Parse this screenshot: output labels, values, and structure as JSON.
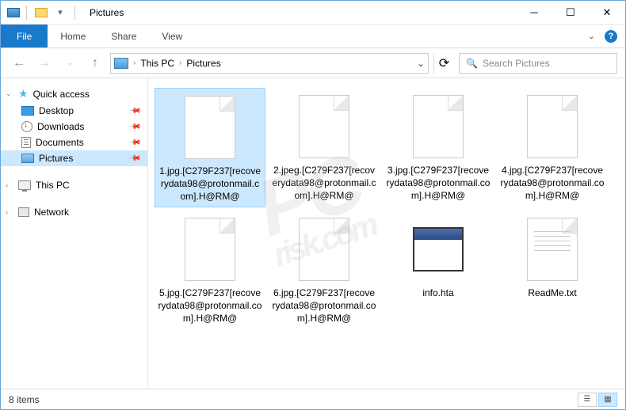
{
  "title": "Pictures",
  "ribbon": {
    "file": "File",
    "tabs": [
      "Home",
      "Share",
      "View"
    ]
  },
  "address": {
    "segments": [
      "This PC",
      "Pictures"
    ]
  },
  "search": {
    "placeholder": "Search Pictures"
  },
  "sidebar": {
    "quick_access": "Quick access",
    "items": [
      {
        "label": "Desktop",
        "icon": "desktop"
      },
      {
        "label": "Downloads",
        "icon": "downloads"
      },
      {
        "label": "Documents",
        "icon": "documents"
      },
      {
        "label": "Pictures",
        "icon": "pictures",
        "selected": true
      }
    ],
    "this_pc": "This PC",
    "network": "Network"
  },
  "files": [
    {
      "name": "1.jpg.[C279F237[recoverydata98@protonmail.com].H@RM@",
      "type": "blank",
      "selected": true
    },
    {
      "name": "2.jpeg.[C279F237[recoverydata98@protonmail.com].H@RM@",
      "type": "blank"
    },
    {
      "name": "3.jpg.[C279F237[recoverydata98@protonmail.com].H@RM@",
      "type": "blank"
    },
    {
      "name": "4.jpg.[C279F237[recoverydata98@protonmail.com].H@RM@",
      "type": "blank"
    },
    {
      "name": "5.jpg.[C279F237[recoverydata98@protonmail.com].H@RM@",
      "type": "blank"
    },
    {
      "name": "6.jpg.[C279F237[recoverydata98@protonmail.com].H@RM@",
      "type": "blank"
    },
    {
      "name": "info.hta",
      "type": "hta"
    },
    {
      "name": "ReadMe.txt",
      "type": "txt"
    }
  ],
  "status": {
    "count": "8 items"
  },
  "watermark": {
    "main": "PC",
    "sub": "risk.com"
  }
}
